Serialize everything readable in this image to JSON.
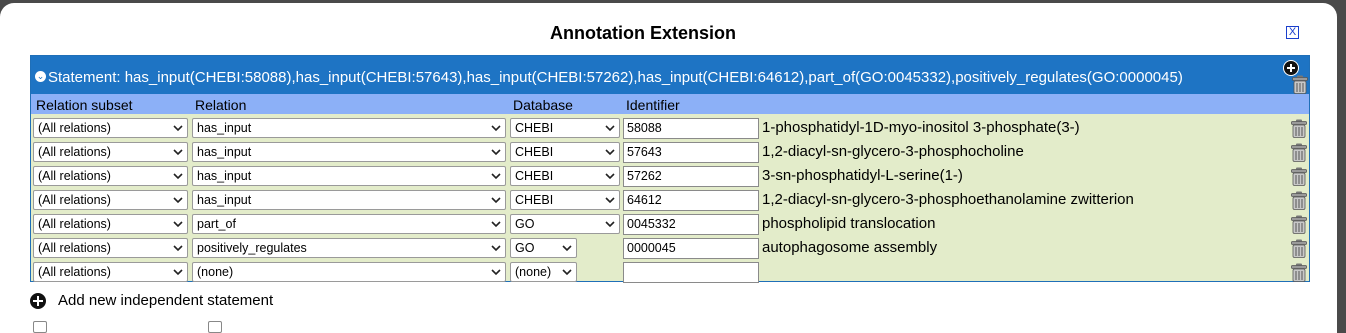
{
  "dialog": {
    "title": "Annotation Extension",
    "close_label": "X"
  },
  "statement": {
    "text": "Statement: has_input(CHEBI:58088),has_input(CHEBI:57643),has_input(CHEBI:57262),has_input(CHEBI:64612),part_of(GO:0045332),positively_regulates(GO:0000045)"
  },
  "columns": {
    "relation_subset": "Relation subset",
    "relation": "Relation",
    "database": "Database",
    "identifier": "Identifier"
  },
  "rows": [
    {
      "subset": "(All relations)",
      "relation": "has_input",
      "database": "CHEBI",
      "identifier": "58088",
      "term": "1-phosphatidyl-1D-myo-inositol 3-phosphate(3-)"
    },
    {
      "subset": "(All relations)",
      "relation": "has_input",
      "database": "CHEBI",
      "identifier": "57643",
      "term": "1,2-diacyl-sn-glycero-3-phosphocholine"
    },
    {
      "subset": "(All relations)",
      "relation": "has_input",
      "database": "CHEBI",
      "identifier": "57262",
      "term": "3-sn-phosphatidyl-L-serine(1-)"
    },
    {
      "subset": "(All relations)",
      "relation": "has_input",
      "database": "CHEBI",
      "identifier": "64612",
      "term": "1,2-diacyl-sn-glycero-3-phosphoethanolamine zwitterion"
    },
    {
      "subset": "(All relations)",
      "relation": "part_of",
      "database": "GO",
      "identifier": "0045332",
      "term": "phospholipid translocation"
    },
    {
      "subset": "(All relations)",
      "relation": "positively_regulates",
      "database": "GO",
      "identifier": "0000045",
      "term": "autophagosome assembly"
    },
    {
      "subset": "(All relations)",
      "relation": "(none)",
      "database": "(none)",
      "identifier": "",
      "term": ""
    }
  ],
  "footer": {
    "add_statement_label": "Add new independent statement"
  },
  "icons": {
    "toggle": "collapse-icon",
    "add": "plus-circle-icon",
    "delete": "trash-icon",
    "dropdown": "chevron-down-icon"
  },
  "colors": {
    "header_blue": "#1e74c4",
    "column_header_blue": "#8cb0f7",
    "row_green": "#e3ecca"
  }
}
